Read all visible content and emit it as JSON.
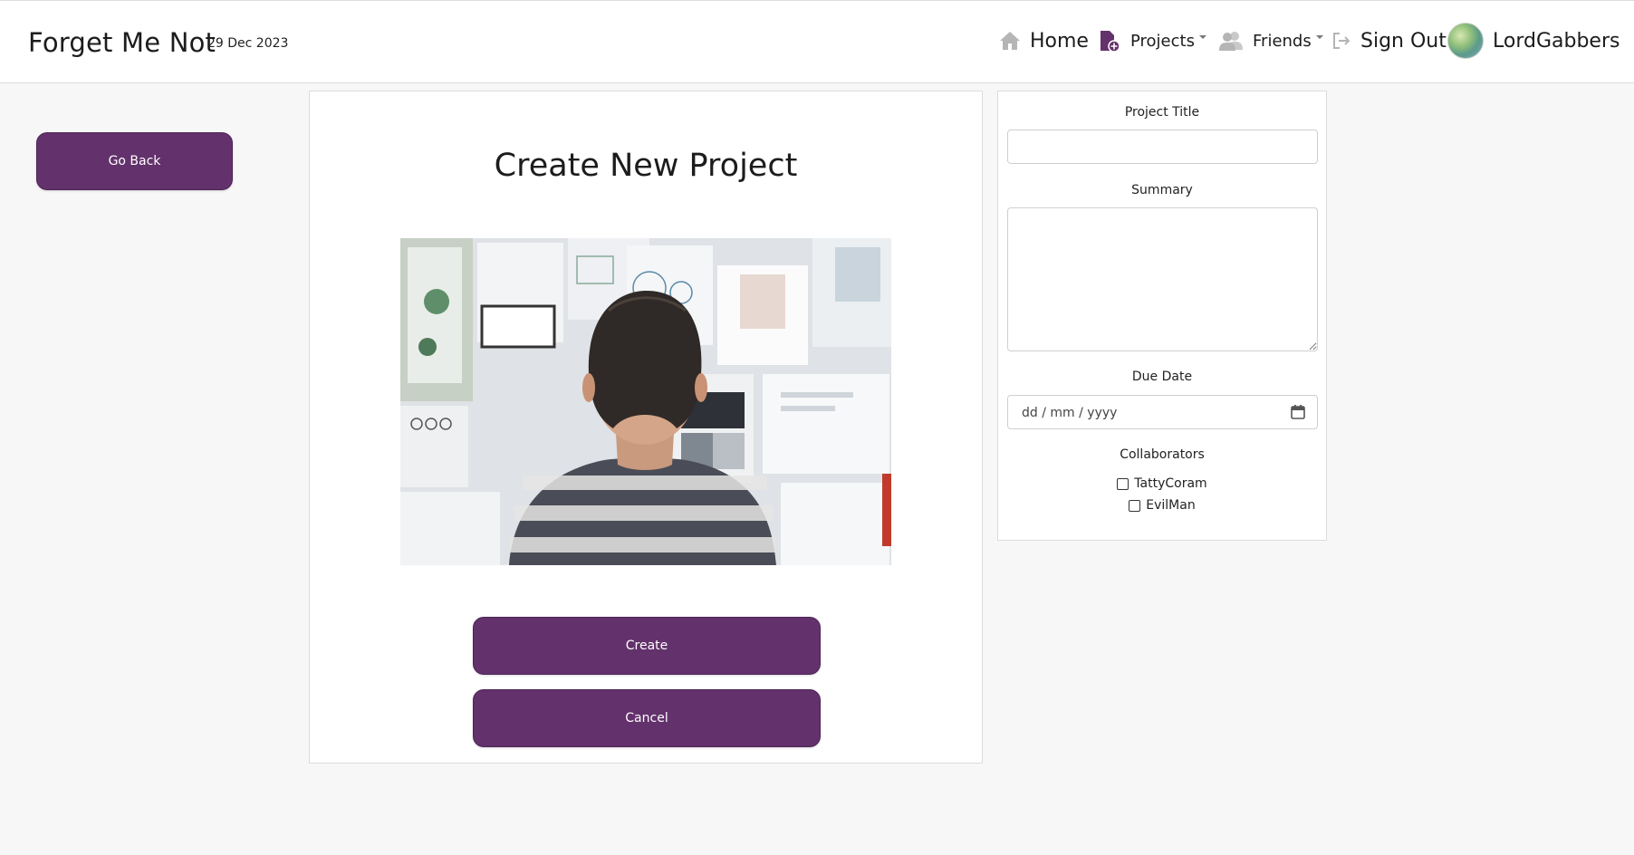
{
  "nav": {
    "brand": "Forget Me Not",
    "date": "29 Dec 2023",
    "items": [
      {
        "label": "Home",
        "icon": "home-icon"
      },
      {
        "label": "Projects",
        "icon": "project-add-icon"
      },
      {
        "label": "Friends",
        "icon": "friends-icon"
      },
      {
        "label": "Sign Out",
        "icon": "sign-out-icon"
      }
    ],
    "user": "LordGabbers"
  },
  "sidebar": {
    "go_back_label": "Go Back"
  },
  "main": {
    "title": "Create New Project",
    "create_label": "Create",
    "cancel_label": "Cancel"
  },
  "form": {
    "title_label": "Project Title",
    "title_value": "",
    "summary_label": "Summary",
    "summary_value": "",
    "due_label": "Due Date",
    "due_placeholder": "dd / mm / yyyy",
    "collaborators_label": "Collaborators",
    "collaborators": [
      {
        "name": "TattyCoram",
        "checked": false
      },
      {
        "name": "EvilMan",
        "checked": false
      }
    ]
  },
  "colors": {
    "accent": "#63316b",
    "background": "#f7f7f7"
  }
}
